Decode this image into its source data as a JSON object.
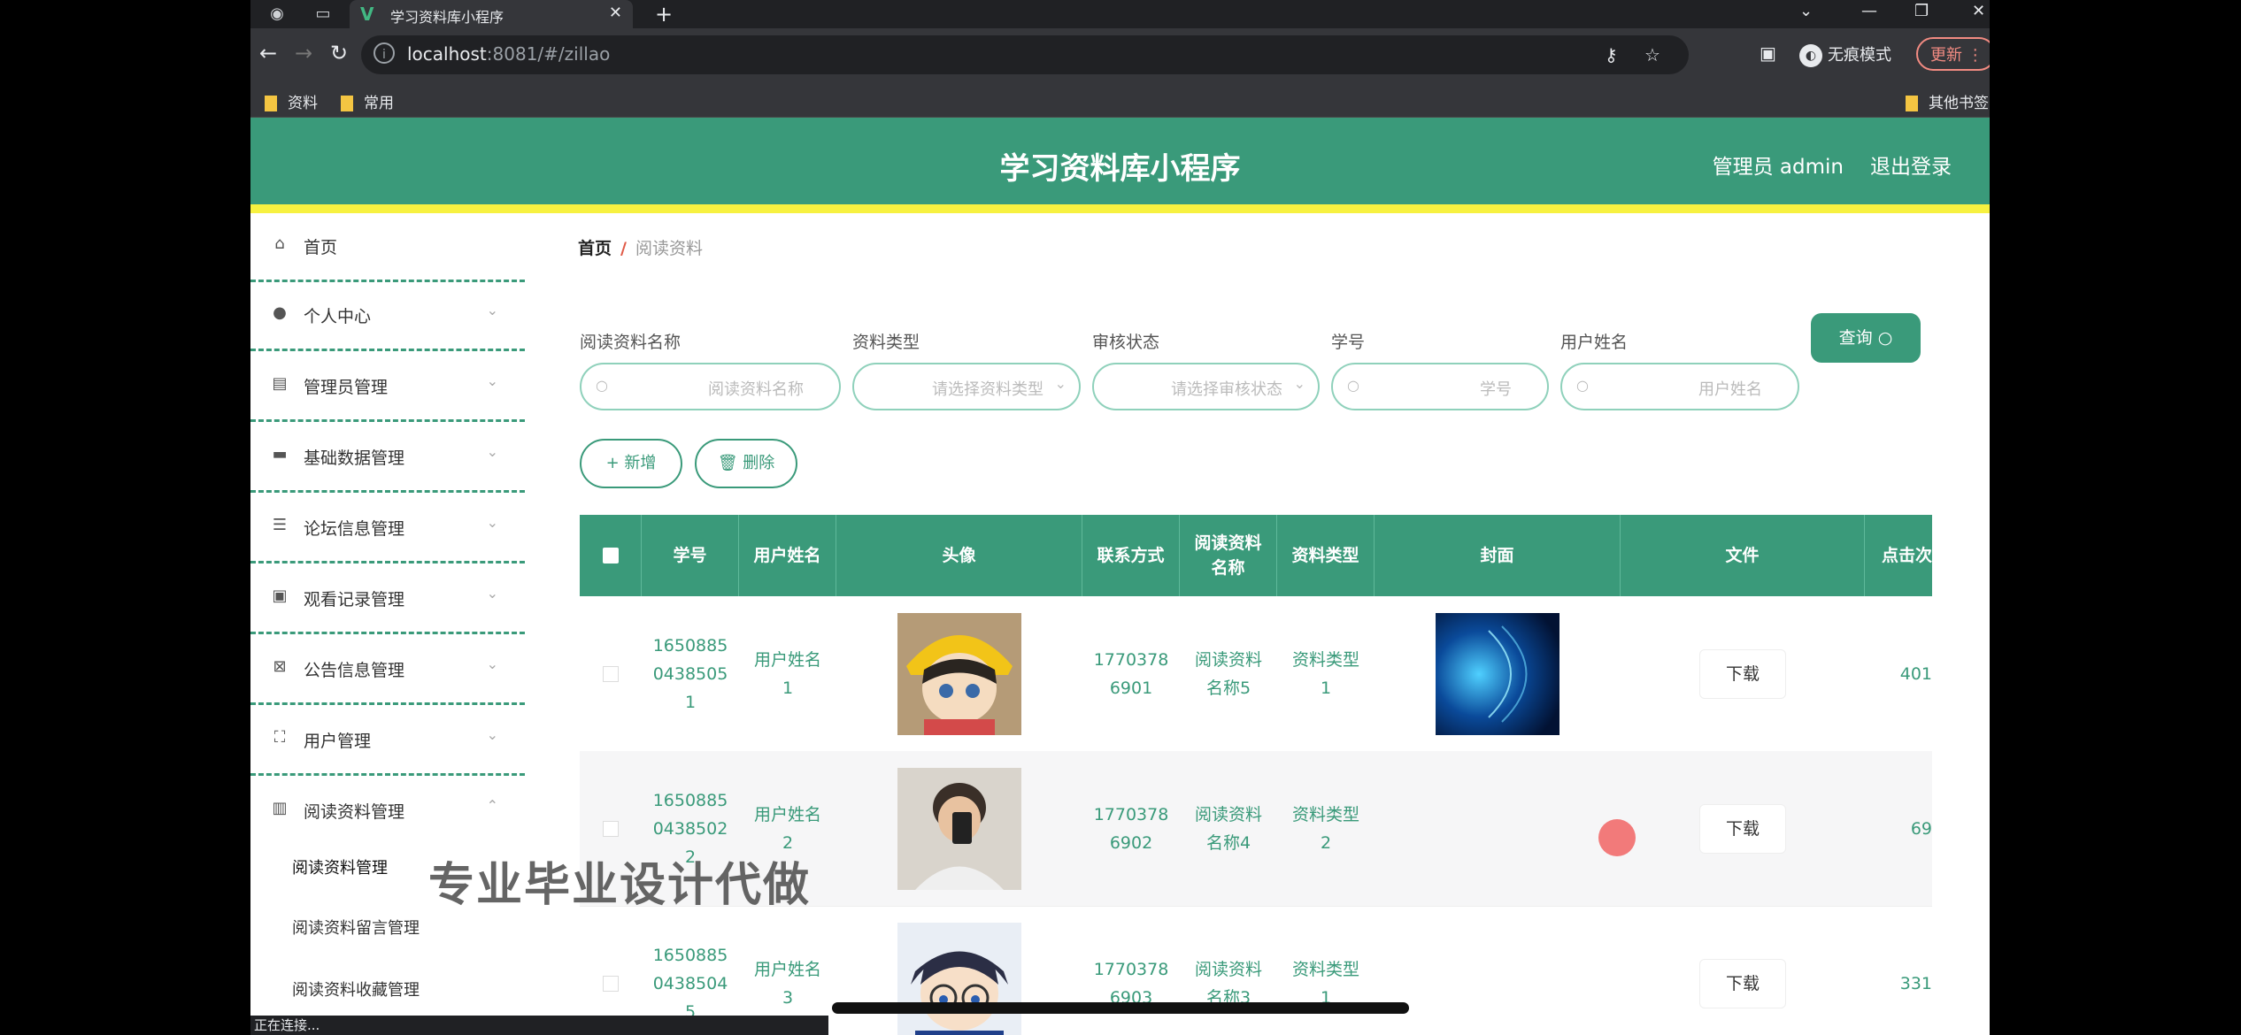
{
  "browser": {
    "tab_title": "学习资料库小程序",
    "url_host": "localhost",
    "url_rest": ":8081/#/zillao",
    "incognito_label": "无痕模式",
    "update_label": "更新",
    "bookmarks": [
      "资料",
      "常用"
    ],
    "other_bookmarks": "其他书签",
    "status_text": "正在连接..."
  },
  "header": {
    "title": "学习资料库小程序",
    "admin_label": "管理员 admin",
    "logout_label": "退出登录"
  },
  "sidebar": {
    "items": [
      {
        "label": "首页",
        "icon": "home-icon"
      },
      {
        "label": "个人中心",
        "icon": "user-icon"
      },
      {
        "label": "管理员管理",
        "icon": "chart-icon"
      },
      {
        "label": "基础数据管理",
        "icon": "chat-icon"
      },
      {
        "label": "论坛信息管理",
        "icon": "sliders-icon"
      },
      {
        "label": "观看记录管理",
        "icon": "briefcase-icon"
      },
      {
        "label": "公告信息管理",
        "icon": "clipboard-x-icon"
      },
      {
        "label": "用户管理",
        "icon": "fullscreen-icon"
      },
      {
        "label": "阅读资料管理",
        "icon": "clipboard-icon"
      }
    ],
    "subitems": [
      "阅读资料管理",
      "阅读资料留言管理",
      "阅读资料收藏管理"
    ]
  },
  "breadcrumb": {
    "home": "首页",
    "sep": "/",
    "current": "阅读资料"
  },
  "filters": {
    "name_label": "阅读资料名称",
    "name_placeholder": "阅读资料名称",
    "type_label": "资料类型",
    "type_placeholder": "请选择资料类型",
    "status_label": "审核状态",
    "status_placeholder": "请选择审核状态",
    "id_label": "学号",
    "id_placeholder": "学号",
    "username_label": "用户姓名",
    "username_placeholder": "用户姓名",
    "query_label": "查询"
  },
  "actions": {
    "add_label": "+ 新增",
    "delete_label": "删除"
  },
  "table": {
    "headers": [
      "学号",
      "用户姓名",
      "头像",
      "联系方式",
      "阅读资料\n名称",
      "资料类型",
      "封面",
      "文件",
      "点击次"
    ],
    "download_label": "下载",
    "rows": [
      {
        "sid": "1650885\n0438505\n1",
        "name": "用户姓名\n1",
        "phone": "1770378\n6901",
        "title": "阅读资料\n名称5",
        "type": "资料类型\n1",
        "clicks": "401"
      },
      {
        "sid": "1650885\n0438502\n2",
        "name": "用户姓名\n2",
        "phone": "1770378\n6902",
        "title": "阅读资料\n名称4",
        "type": "资料类型\n2",
        "clicks": "69"
      },
      {
        "sid": "1650885\n0438504\n5",
        "name": "用户姓名\n3",
        "phone": "1770378\n6903",
        "title": "阅读资料\n名称3",
        "type": "资料类型\n1",
        "clicks": "331"
      }
    ]
  },
  "overlay": {
    "watermark": "专业毕业设计代做"
  },
  "colors": {
    "primary": "#3a9a7a",
    "accent_bar": "#f7f140",
    "breadcrumb_sep": "#e05a47"
  }
}
